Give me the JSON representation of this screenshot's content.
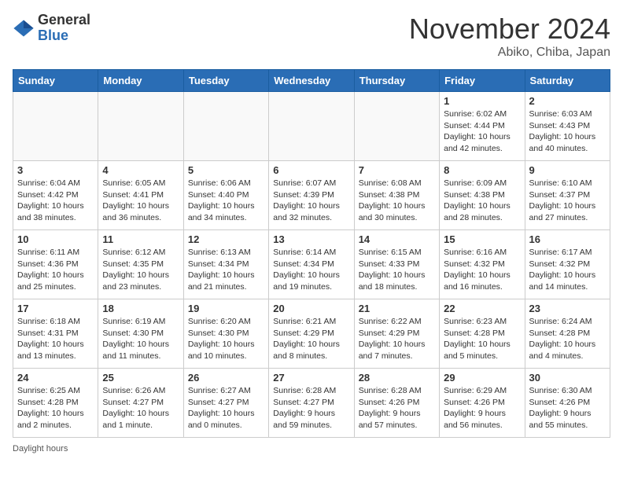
{
  "header": {
    "logo_general": "General",
    "logo_blue": "Blue",
    "month_title": "November 2024",
    "location": "Abiko, Chiba, Japan"
  },
  "days_of_week": [
    "Sunday",
    "Monday",
    "Tuesday",
    "Wednesday",
    "Thursday",
    "Friday",
    "Saturday"
  ],
  "weeks": [
    [
      {
        "day": "",
        "info": ""
      },
      {
        "day": "",
        "info": ""
      },
      {
        "day": "",
        "info": ""
      },
      {
        "day": "",
        "info": ""
      },
      {
        "day": "",
        "info": ""
      },
      {
        "day": "1",
        "info": "Sunrise: 6:02 AM\nSunset: 4:44 PM\nDaylight: 10 hours\nand 42 minutes."
      },
      {
        "day": "2",
        "info": "Sunrise: 6:03 AM\nSunset: 4:43 PM\nDaylight: 10 hours\nand 40 minutes."
      }
    ],
    [
      {
        "day": "3",
        "info": "Sunrise: 6:04 AM\nSunset: 4:42 PM\nDaylight: 10 hours\nand 38 minutes."
      },
      {
        "day": "4",
        "info": "Sunrise: 6:05 AM\nSunset: 4:41 PM\nDaylight: 10 hours\nand 36 minutes."
      },
      {
        "day": "5",
        "info": "Sunrise: 6:06 AM\nSunset: 4:40 PM\nDaylight: 10 hours\nand 34 minutes."
      },
      {
        "day": "6",
        "info": "Sunrise: 6:07 AM\nSunset: 4:39 PM\nDaylight: 10 hours\nand 32 minutes."
      },
      {
        "day": "7",
        "info": "Sunrise: 6:08 AM\nSunset: 4:38 PM\nDaylight: 10 hours\nand 30 minutes."
      },
      {
        "day": "8",
        "info": "Sunrise: 6:09 AM\nSunset: 4:38 PM\nDaylight: 10 hours\nand 28 minutes."
      },
      {
        "day": "9",
        "info": "Sunrise: 6:10 AM\nSunset: 4:37 PM\nDaylight: 10 hours\nand 27 minutes."
      }
    ],
    [
      {
        "day": "10",
        "info": "Sunrise: 6:11 AM\nSunset: 4:36 PM\nDaylight: 10 hours\nand 25 minutes."
      },
      {
        "day": "11",
        "info": "Sunrise: 6:12 AM\nSunset: 4:35 PM\nDaylight: 10 hours\nand 23 minutes."
      },
      {
        "day": "12",
        "info": "Sunrise: 6:13 AM\nSunset: 4:34 PM\nDaylight: 10 hours\nand 21 minutes."
      },
      {
        "day": "13",
        "info": "Sunrise: 6:14 AM\nSunset: 4:34 PM\nDaylight: 10 hours\nand 19 minutes."
      },
      {
        "day": "14",
        "info": "Sunrise: 6:15 AM\nSunset: 4:33 PM\nDaylight: 10 hours\nand 18 minutes."
      },
      {
        "day": "15",
        "info": "Sunrise: 6:16 AM\nSunset: 4:32 PM\nDaylight: 10 hours\nand 16 minutes."
      },
      {
        "day": "16",
        "info": "Sunrise: 6:17 AM\nSunset: 4:32 PM\nDaylight: 10 hours\nand 14 minutes."
      }
    ],
    [
      {
        "day": "17",
        "info": "Sunrise: 6:18 AM\nSunset: 4:31 PM\nDaylight: 10 hours\nand 13 minutes."
      },
      {
        "day": "18",
        "info": "Sunrise: 6:19 AM\nSunset: 4:30 PM\nDaylight: 10 hours\nand 11 minutes."
      },
      {
        "day": "19",
        "info": "Sunrise: 6:20 AM\nSunset: 4:30 PM\nDaylight: 10 hours\nand 10 minutes."
      },
      {
        "day": "20",
        "info": "Sunrise: 6:21 AM\nSunset: 4:29 PM\nDaylight: 10 hours\nand 8 minutes."
      },
      {
        "day": "21",
        "info": "Sunrise: 6:22 AM\nSunset: 4:29 PM\nDaylight: 10 hours\nand 7 minutes."
      },
      {
        "day": "22",
        "info": "Sunrise: 6:23 AM\nSunset: 4:28 PM\nDaylight: 10 hours\nand 5 minutes."
      },
      {
        "day": "23",
        "info": "Sunrise: 6:24 AM\nSunset: 4:28 PM\nDaylight: 10 hours\nand 4 minutes."
      }
    ],
    [
      {
        "day": "24",
        "info": "Sunrise: 6:25 AM\nSunset: 4:28 PM\nDaylight: 10 hours\nand 2 minutes."
      },
      {
        "day": "25",
        "info": "Sunrise: 6:26 AM\nSunset: 4:27 PM\nDaylight: 10 hours\nand 1 minute."
      },
      {
        "day": "26",
        "info": "Sunrise: 6:27 AM\nSunset: 4:27 PM\nDaylight: 10 hours\nand 0 minutes."
      },
      {
        "day": "27",
        "info": "Sunrise: 6:28 AM\nSunset: 4:27 PM\nDaylight: 9 hours\nand 59 minutes."
      },
      {
        "day": "28",
        "info": "Sunrise: 6:28 AM\nSunset: 4:26 PM\nDaylight: 9 hours\nand 57 minutes."
      },
      {
        "day": "29",
        "info": "Sunrise: 6:29 AM\nSunset: 4:26 PM\nDaylight: 9 hours\nand 56 minutes."
      },
      {
        "day": "30",
        "info": "Sunrise: 6:30 AM\nSunset: 4:26 PM\nDaylight: 9 hours\nand 55 minutes."
      }
    ]
  ],
  "footer": {
    "daylight_hours_label": "Daylight hours"
  }
}
